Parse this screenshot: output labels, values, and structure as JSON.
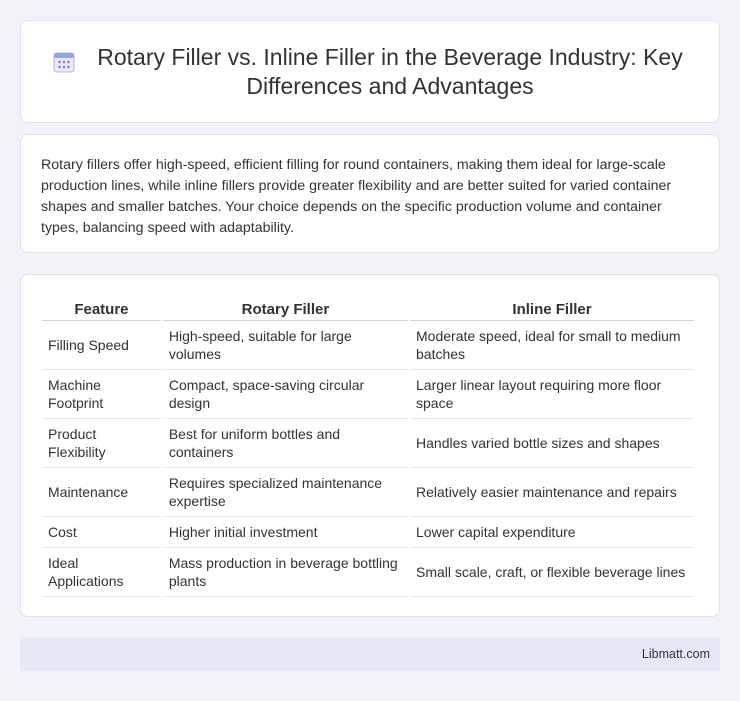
{
  "header": {
    "icon": "calendar-icon",
    "title": "Rotary Filler vs. Inline Filler in the Beverage Industry: Key Differences and Advantages"
  },
  "summary": {
    "text": "Rotary fillers offer high-speed, efficient filling for round containers, making them ideal for large-scale production lines, while inline fillers provide greater flexibility and are better suited for varied container shapes and smaller batches. Your choice depends on the specific production volume and container types, balancing speed with adaptability."
  },
  "table": {
    "headers": [
      "Feature",
      "Rotary Filler",
      "Inline Filler"
    ],
    "rows": [
      [
        "Filling Speed",
        "High-speed, suitable for large volumes",
        "Moderate speed, ideal for small to medium batches"
      ],
      [
        "Machine Footprint",
        "Compact, space-saving circular design",
        "Larger linear layout requiring more floor space"
      ],
      [
        "Product Flexibility",
        "Best for uniform bottles and containers",
        "Handles varied bottle sizes and shapes"
      ],
      [
        "Maintenance",
        "Requires specialized maintenance expertise",
        "Relatively easier maintenance and repairs"
      ],
      [
        "Cost",
        "Higher initial investment",
        "Lower capital expenditure"
      ],
      [
        "Ideal Applications",
        "Mass production in beverage bottling plants",
        "Small scale, craft, or flexible beverage lines"
      ]
    ]
  },
  "footer": {
    "text": "Libmatt.com"
  },
  "colors": {
    "background": "#f1f3f9",
    "card": "#ffffff",
    "footer": "#e5e9f5",
    "icon_accent": "#8a7fe0"
  }
}
